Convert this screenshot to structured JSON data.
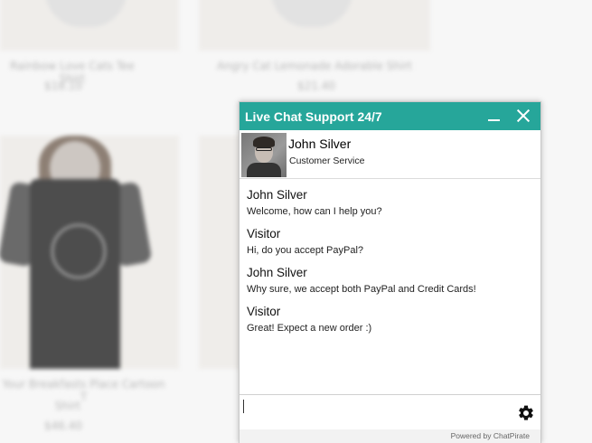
{
  "background": {
    "products": [
      {
        "name": "Rainbow Love Cats Tee Shirt",
        "price": "$18.10"
      },
      {
        "name": "Angry Cat Lemonade Adorable Shirt",
        "price": "$21.40"
      },
      {
        "name": "Your Breakfasts Place Cartoon T",
        "name_cont": "Shirt",
        "price": "$46.40"
      }
    ]
  },
  "chat": {
    "title": "Live Chat Support 24/7",
    "agent": {
      "name": "John Silver",
      "role": "Customer Service"
    },
    "messages": [
      {
        "sender": "John Silver",
        "text": "Welcome, how can I help you?"
      },
      {
        "sender": "Visitor",
        "text": "Hi, do you accept PayPal?"
      },
      {
        "sender": "John Silver",
        "text": "Why sure, we accept both PayPal and Credit Cards!"
      },
      {
        "sender": "Visitor",
        "text": "Great! Expect a new order :)"
      }
    ],
    "input": {
      "value": "",
      "placeholder": ""
    },
    "footer": "Powered by ChatPirate",
    "icons": {
      "minimize": "minimize-icon",
      "close": "close-icon",
      "settings": "gear-icon"
    },
    "colors": {
      "header": "#26a69a"
    }
  }
}
